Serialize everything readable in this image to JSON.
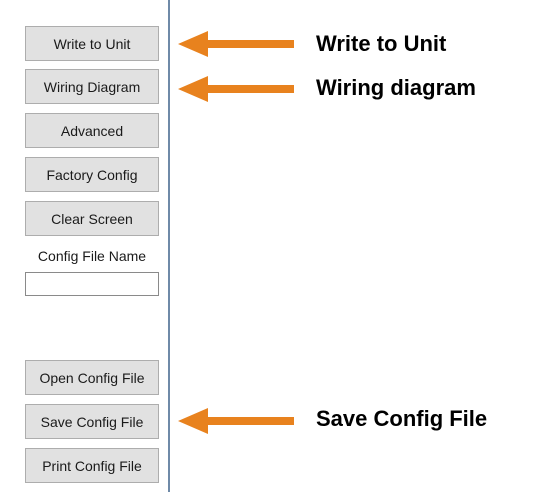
{
  "panel": {
    "buttons": {
      "write_to_unit": "Write to Unit",
      "wiring_diagram": "Wiring Diagram",
      "advanced": "Advanced",
      "factory_config": "Factory Config",
      "clear_screen": "Clear Screen",
      "open_config_file": "Open Config File",
      "save_config_file": "Save Config File",
      "print_config_file": "Print Config File"
    },
    "config_file_name": {
      "label": "Config File Name",
      "value": ""
    }
  },
  "annotations": {
    "arrow_color": "#e8821e",
    "write_to_unit": "Write to Unit",
    "wiring_diagram": "Wiring diagram",
    "save_config_file": "Save Config File"
  }
}
